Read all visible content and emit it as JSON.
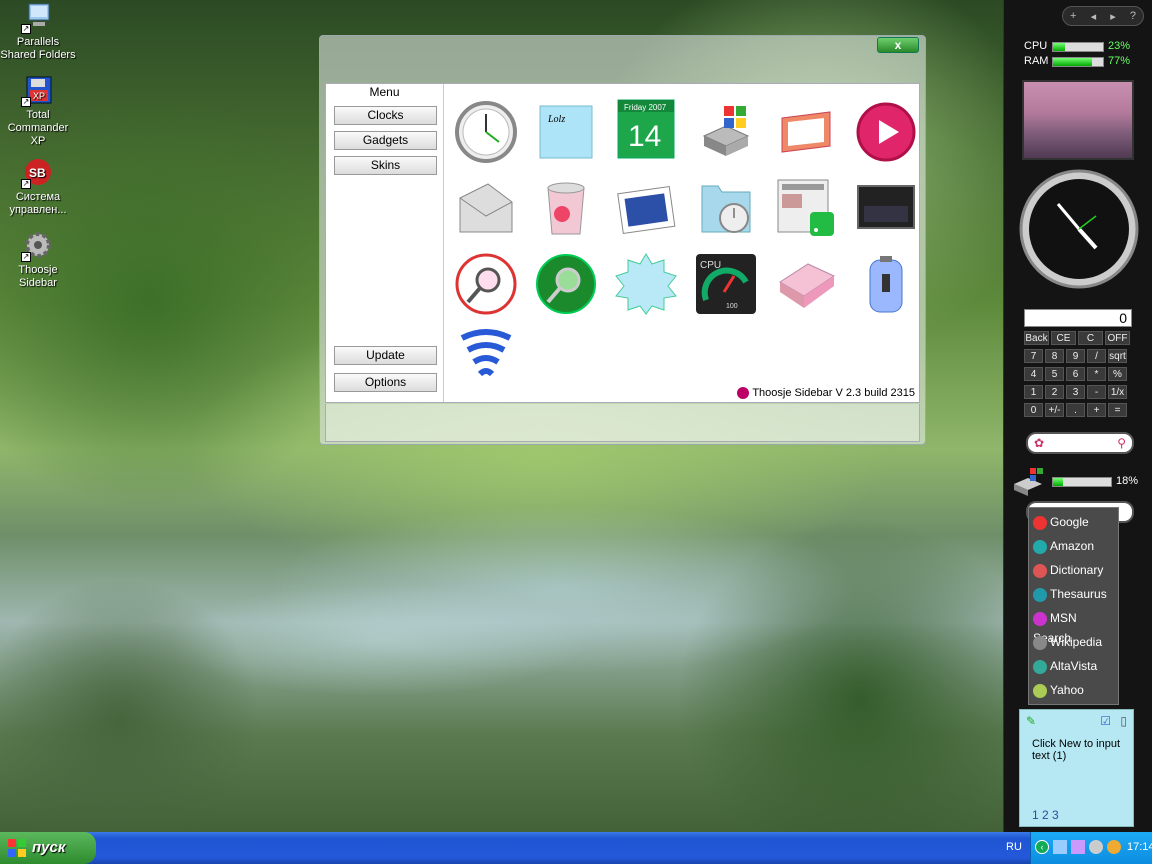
{
  "desktop": {
    "icons": [
      {
        "label": "Parallels Shared Folders"
      },
      {
        "label": "Total Commander XP"
      },
      {
        "label": "Система управлен..."
      },
      {
        "label": "Thoosje Sidebar"
      }
    ]
  },
  "window": {
    "close_label": "x",
    "menu_title": "Menu",
    "menu_buttons": [
      "Clocks",
      "Gadgets",
      "Skins"
    ],
    "update_label": "Update",
    "options_label": "Options",
    "version": "Thoosje Sidebar V 2.3  build 2315",
    "calendar": {
      "day_name": "Friday 2007",
      "day": "14"
    },
    "sticky_text": "Lolz",
    "cpu_gauge_label": "CPU",
    "cpu_gauge_value": "100",
    "gadgets": [
      "analog-clock-icon",
      "sticky-note-icon",
      "calendar-icon",
      "disk-icon",
      "slideshow-icon",
      "media-player-icon",
      "mail-icon",
      "recycle-bin-icon",
      "photo-viewer-icon",
      "folder-clock-icon",
      "rss-news-icon",
      "monitor-icon",
      "search-icon",
      "green-search-icon",
      "starburst-icon",
      "cpu-gauge-icon",
      "calculator-icon",
      "battery-icon",
      "wifi-icon"
    ]
  },
  "sidebar": {
    "controls": [
      "+",
      "◂",
      "▸",
      "?"
    ],
    "cpu_label": "CPU",
    "cpu_pct": "23%",
    "cpu_value": 0.23,
    "ram_label": "RAM",
    "ram_pct": "77%",
    "ram_value": 0.77,
    "calc_display": "0",
    "calc_keys": [
      [
        "Back",
        "CE",
        "C",
        "OFF"
      ],
      [
        "7",
        "8",
        "9",
        "/",
        "sqrt"
      ],
      [
        "4",
        "5",
        "6",
        "*",
        "%"
      ],
      [
        "1",
        "2",
        "3",
        "-",
        "1/x"
      ],
      [
        "0",
        "+/-",
        ".",
        "+",
        "="
      ]
    ],
    "disk_pct": "18%",
    "disk_value": 0.18,
    "search_engines": [
      "Google",
      "Amazon",
      "Dictionary",
      "Thesaurus",
      "MSN Search",
      "Wikipedia",
      "AltaVista",
      "Yahoo"
    ],
    "engine_colors": [
      "#e33",
      "#2aa",
      "#d55",
      "#29a",
      "#c3c",
      "#888",
      "#3a9",
      "#ac5"
    ],
    "note_text": "Click New to input text (1)",
    "note_pages": "1 2 3"
  },
  "taskbar": {
    "start_label": "пуск",
    "lang": "RU",
    "time": "17:14"
  }
}
